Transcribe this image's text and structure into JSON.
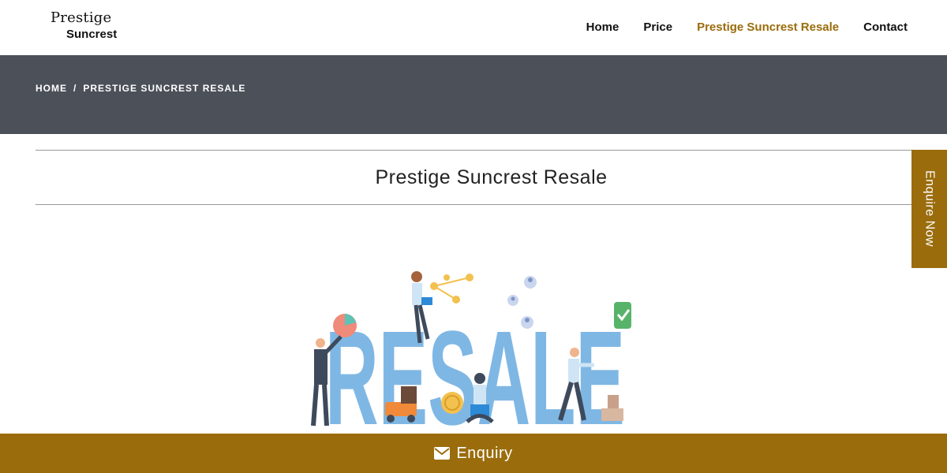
{
  "logo": {
    "line1": "Prestige",
    "line2": "Suncrest"
  },
  "nav": {
    "home": "Home",
    "price": "Price",
    "resale": "Prestige Suncrest Resale",
    "contact": "Contact"
  },
  "breadcrumb": {
    "home": "HOME",
    "separator": "/",
    "current": "PRESTIGE SUNCREST RESALE"
  },
  "page": {
    "title": "Prestige Suncrest Resale"
  },
  "illustration": {
    "word": "RESALE",
    "icon": "resale-illustration"
  },
  "side_tab": {
    "label": "Enquire Now"
  },
  "footer": {
    "label": "Enquiry",
    "icon": "envelope-icon"
  },
  "colors": {
    "accent": "#9a6c0c",
    "banner": "#4b5059",
    "letters": "#7fb7e4"
  }
}
